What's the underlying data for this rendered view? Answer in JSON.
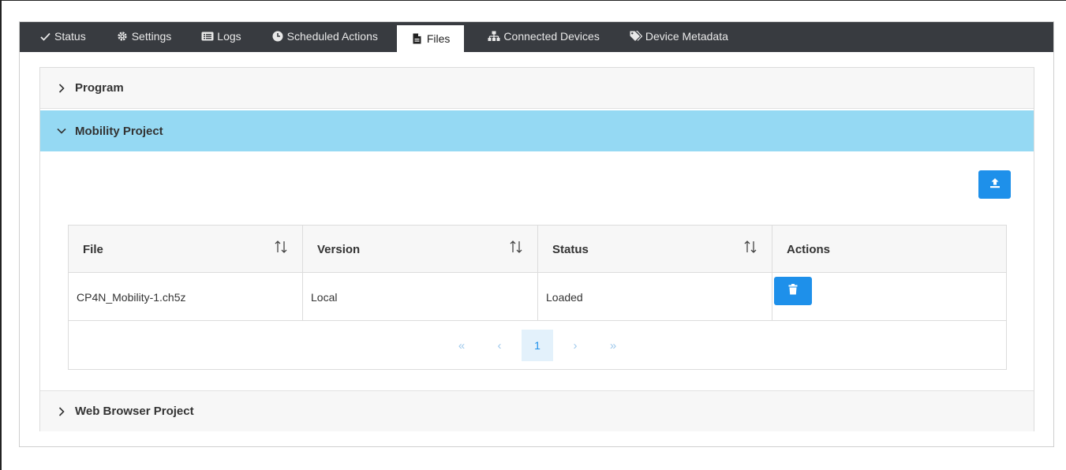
{
  "tabs": [
    {
      "label": "Status",
      "icon": "check-icon"
    },
    {
      "label": "Settings",
      "icon": "gear-icon"
    },
    {
      "label": "Logs",
      "icon": "list-icon"
    },
    {
      "label": "Scheduled Actions",
      "icon": "clock-icon"
    },
    {
      "label": "Files",
      "icon": "file-icon",
      "active": true
    },
    {
      "label": "Connected Devices",
      "icon": "sitemap-icon"
    },
    {
      "label": "Device Metadata",
      "icon": "tags-icon"
    }
  ],
  "accordion": {
    "sections": [
      {
        "title": "Program",
        "expanded": false
      },
      {
        "title": "Mobility Project",
        "expanded": true
      },
      {
        "title": "Web Browser Project",
        "expanded": false
      }
    ]
  },
  "files_table": {
    "columns": [
      "File",
      "Version",
      "Status",
      "Actions"
    ],
    "rows": [
      {
        "file": "CP4N_Mobility-1.ch5z",
        "version": "Local",
        "status": "Loaded"
      }
    ]
  },
  "pagination": {
    "first": "«",
    "prev": "‹",
    "current_page": "1",
    "next": "›",
    "last": "»"
  },
  "colors": {
    "tabbar_bg": "#383b40",
    "expanded_header_bg": "#95d9f3",
    "primary_button": "#1e90ea"
  }
}
